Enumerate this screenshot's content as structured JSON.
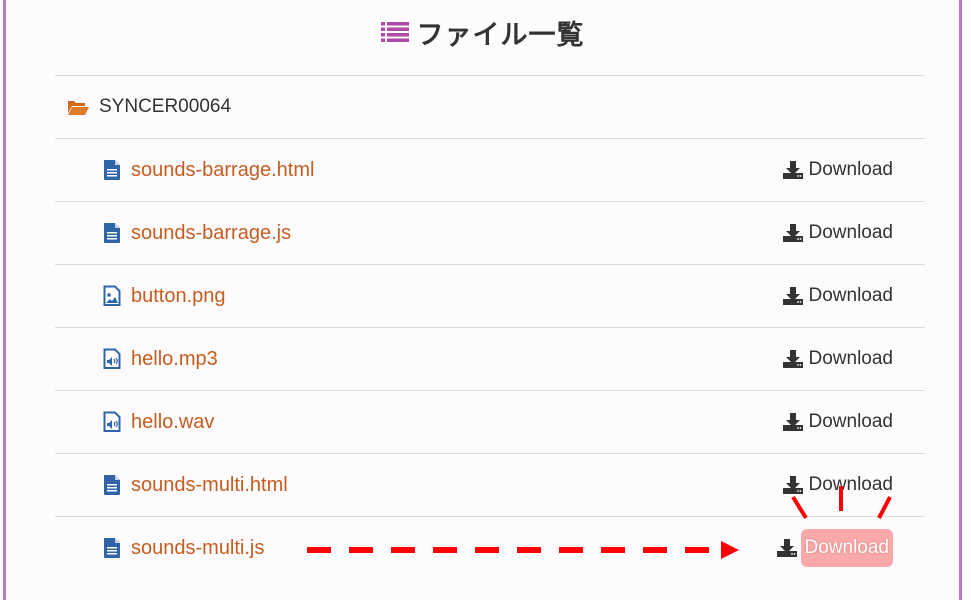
{
  "header": {
    "title": "ファイル一覧",
    "icon": "list-icon",
    "accent_color": "#b04aa8"
  },
  "folder": {
    "name": "SYNCER00064",
    "icon": "folder-open-icon",
    "icon_color": "#d2691e"
  },
  "files": [
    {
      "name": "sounds-barrage.html",
      "icon": "file-text-icon",
      "download_label": "Download"
    },
    {
      "name": "sounds-barrage.js",
      "icon": "file-text-icon",
      "download_label": "Download"
    },
    {
      "name": "button.png",
      "icon": "file-image-icon",
      "download_label": "Download"
    },
    {
      "name": "hello.mp3",
      "icon": "file-audio-icon",
      "download_label": "Download"
    },
    {
      "name": "hello.wav",
      "icon": "file-audio-icon",
      "download_label": "Download"
    },
    {
      "name": "sounds-multi.html",
      "icon": "file-text-icon",
      "download_label": "Download"
    },
    {
      "name": "sounds-multi.js",
      "icon": "file-text-icon",
      "download_label": "Download",
      "highlighted": true
    }
  ],
  "colors": {
    "link": "#c65d1e",
    "file_icon": "#2f64a8",
    "frame_border": "#b57cbd",
    "annotation": "#ff0000",
    "highlight_bg": "#f9a9a9"
  },
  "annotation": {
    "type": "dashed-arrow-to-highlighted-download",
    "target_file": "sounds-multi.js"
  }
}
